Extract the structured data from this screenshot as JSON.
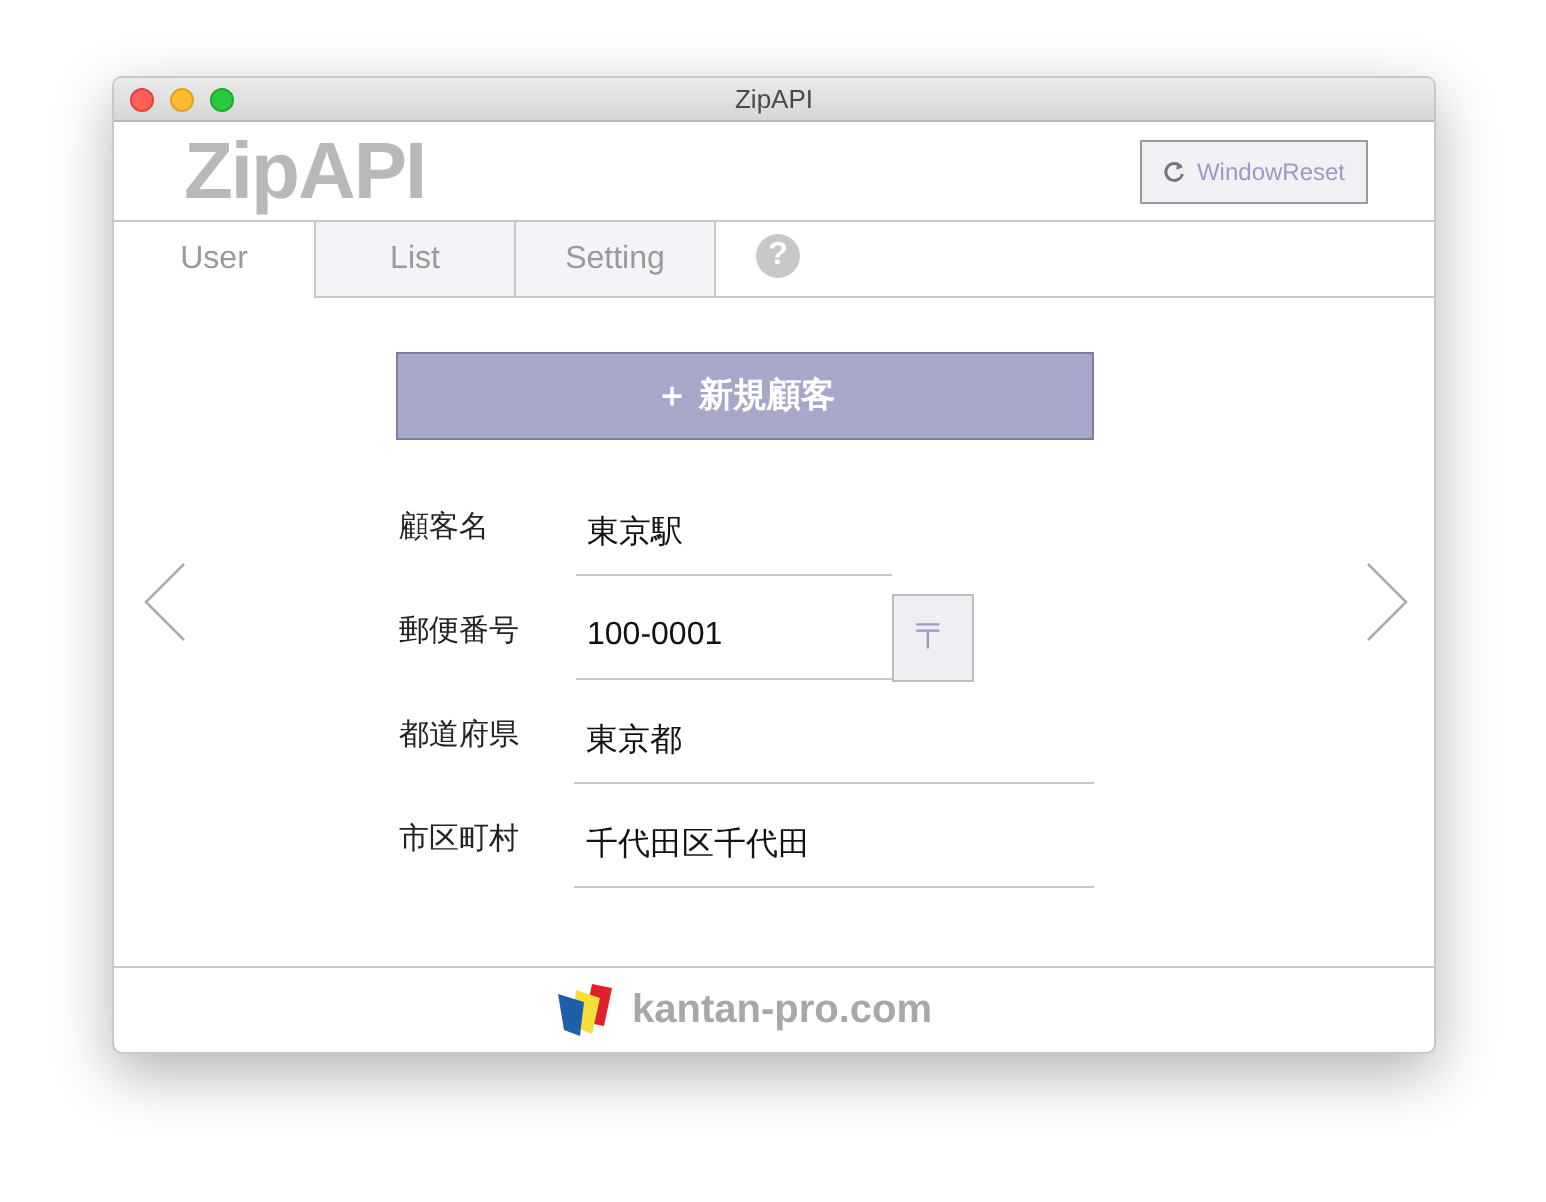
{
  "window": {
    "title": "ZipAPI"
  },
  "header": {
    "logo": "ZipAPI",
    "reset_button": "WindowReset"
  },
  "tabs": [
    {
      "label": "User",
      "selected": true
    },
    {
      "label": "List",
      "selected": false
    },
    {
      "label": "Setting",
      "selected": false
    }
  ],
  "help_button": "?",
  "new_customer_button": "＋ 新規顧客",
  "form": [
    {
      "label": "顧客名",
      "value": "東京駅",
      "kind": "short"
    },
    {
      "label": "郵便番号",
      "value": "100-0001",
      "kind": "postal",
      "button": "〒"
    },
    {
      "label": "都道府県",
      "value": "東京都",
      "kind": "wide"
    },
    {
      "label": "市区町村",
      "value": "千代田区千代田",
      "kind": "wide"
    }
  ],
  "footer": {
    "brand": "kantan-pro.com"
  }
}
